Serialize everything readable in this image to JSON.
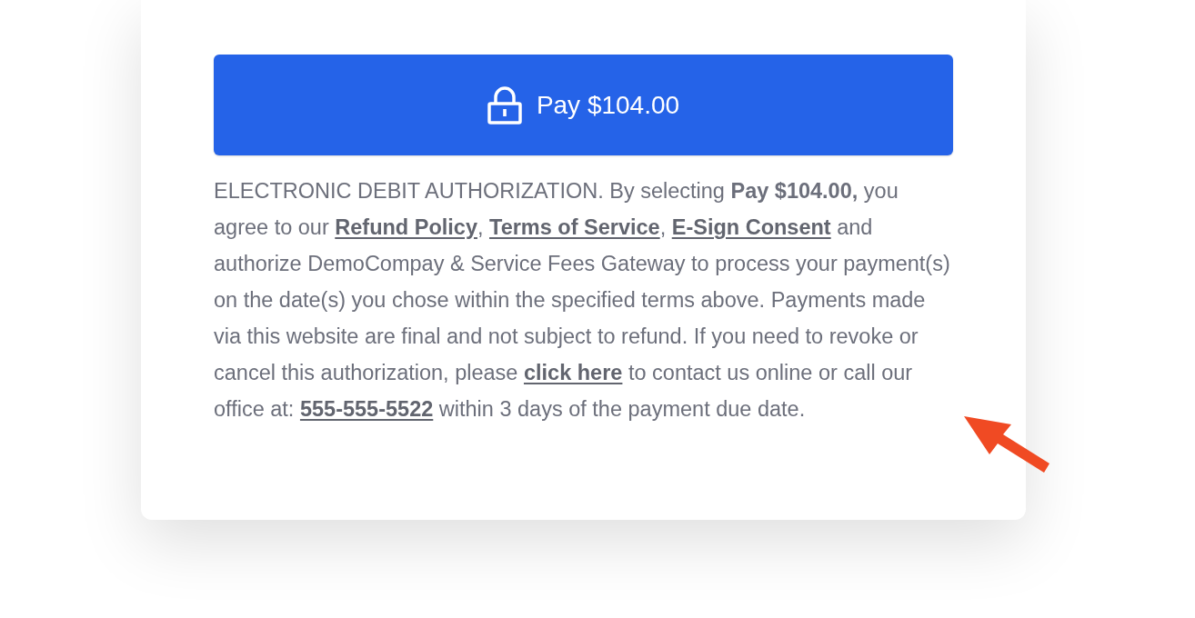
{
  "payment_card": {
    "pay_button": {
      "label": "Pay $104.00"
    },
    "authorization": {
      "parts": [
        {
          "kind": "text",
          "text": "ELECTRONIC DEBIT AUTHORIZATION. By selecting **Pay $104.00,** you agree to our "
        },
        {
          "kind": "link",
          "text": "Refund Policy"
        },
        {
          "kind": "text",
          "text": ", "
        },
        {
          "kind": "link",
          "text": "Terms of Service"
        },
        {
          "kind": "text",
          "text": ", "
        },
        {
          "kind": "link",
          "text": "E-Sign Consent"
        },
        {
          "kind": "text",
          "text": " and authorize DemoCompay & Service Fees Gateway to process your payment(s) on the date(s) you chose within the specified terms above. Payments made via this website are final and not subject to refund. If you need to revoke or cancel this authorization, please "
        },
        {
          "kind": "link",
          "text": "click here"
        },
        {
          "kind": "text",
          "text": " to contact us online or call our office at: "
        },
        {
          "kind": "link",
          "text": "555-555-5522"
        },
        {
          "kind": "text",
          "text": " within 3 days of the payment due date."
        }
      ]
    }
  }
}
